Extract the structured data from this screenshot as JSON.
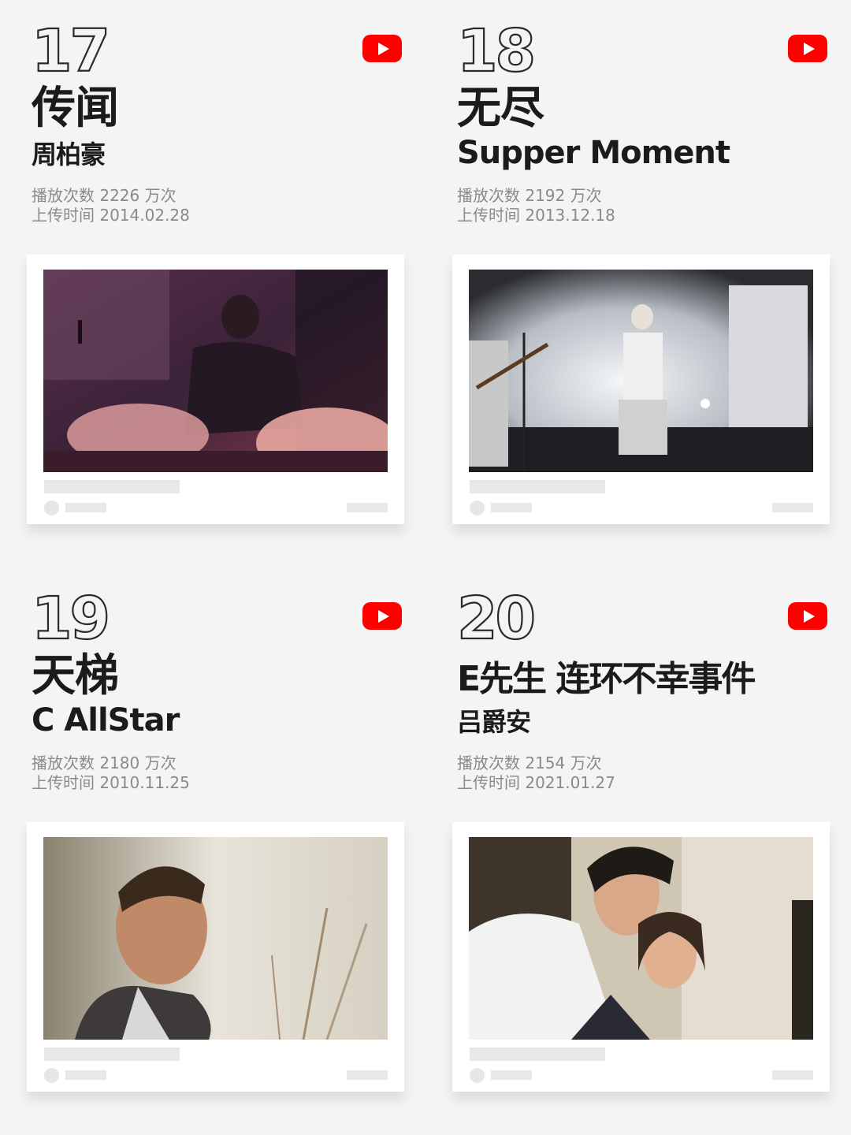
{
  "entries": [
    {
      "rank": "17",
      "title": "传闻",
      "artist": "周柏豪",
      "plays_label": "播放次数",
      "plays_value": "2226 万次",
      "upload_label": "上传时间",
      "upload_date": "2014.02.28",
      "icon": "youtube-icon"
    },
    {
      "rank": "18",
      "title": "无尽",
      "artist": "Supper Moment",
      "plays_label": "播放次数",
      "plays_value": "2192 万次",
      "upload_label": "上传时间",
      "upload_date": "2013.12.18",
      "icon": "youtube-icon"
    },
    {
      "rank": "19",
      "title": "天梯",
      "artist": "C AllStar",
      "plays_label": "播放次数",
      "plays_value": "2180 万次",
      "upload_label": "上传时间",
      "upload_date": "2010.11.25",
      "icon": "youtube-icon"
    },
    {
      "rank": "20",
      "title": "E先生 连环不幸事件",
      "artist": "吕爵安",
      "plays_label": "播放次数",
      "plays_value": "2154 万次",
      "upload_label": "上传时间",
      "upload_date": "2021.01.27",
      "icon": "youtube-icon"
    }
  ],
  "colors": {
    "background": "#f4f4f4",
    "youtube_red": "#ff0000",
    "stat_text": "#8a8a8a",
    "placeholder_bar": "#e8e8e8"
  }
}
